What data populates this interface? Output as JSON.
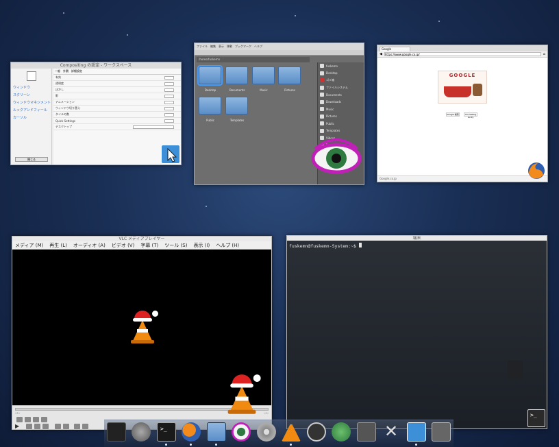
{
  "windows": {
    "settings": {
      "title": "Compositing の設定 - ワークスペース",
      "side_items": [
        "ウィンドウ",
        "スクリーン",
        "ウィンドウマネジメント",
        "ルックアンドフィール",
        "カーソル"
      ],
      "tabs": [
        "一般",
        "外観",
        "詳細設定"
      ],
      "rows": [
        "有効",
        "透明度",
        "ぼかし",
        "影",
        "アニメーション",
        "ウィンドウ切り替え",
        "タイルの数",
        "Quick Settings",
        "デスクトップ"
      ],
      "footer_button": "閉じる"
    },
    "files": {
      "title": "ファイルマネージャー",
      "menu": [
        "ファイル",
        "編集",
        "表示",
        "移動",
        "ブックマーク",
        "ヘルプ"
      ],
      "path": "/home/fuskemn",
      "folders": [
        "Desktop",
        "Documents",
        "Music",
        "Pictures",
        "Public",
        "Templates"
      ],
      "places": [
        "fuskemn",
        "Desktop",
        "ゴミ箱",
        "ファイルシステム",
        "Documents",
        "Downloads",
        "Music",
        "Pictures",
        "Public",
        "Templates",
        "Videos",
        "Network"
      ]
    },
    "browser": {
      "title": "Google - Mozilla Firefox",
      "tab": "Google",
      "url": "https://www.google.co.jp/",
      "doodle_text": "GOOGLE",
      "buttons": [
        "Google 検索",
        "I'm Feeling Lucky"
      ],
      "footer": "Google.co.jp"
    },
    "vlc": {
      "title": "VLC メディアプレイヤー",
      "menu": [
        "メディア (M)",
        "再生 (L)",
        "オーディオ (A)",
        "ビデオ (V)",
        "字幕 (T)",
        "ツール (S)",
        "表示 (I)",
        "ヘルプ (H)"
      ],
      "time_left": "--:--",
      "time_right": "--:--"
    },
    "terminal": {
      "title": "端末",
      "prompt": "fuskemn@fuskemn-System:~$ "
    }
  },
  "dock": {
    "items": [
      "display-icon",
      "rocket-icon",
      "terminal-icon",
      "firefox-icon",
      "files-icon",
      "eye-icon",
      "disc-icon",
      "vlc-icon",
      "appstore-icon",
      "globe-icon",
      "camera-icon",
      "tools-icon",
      "cursor-icon",
      "screenshot-icon"
    ]
  },
  "colors": {
    "desktop": "#1a2f55",
    "accent": "#4b9bf0",
    "vlc_orange": "#f08a10",
    "hat_red": "#d22"
  }
}
